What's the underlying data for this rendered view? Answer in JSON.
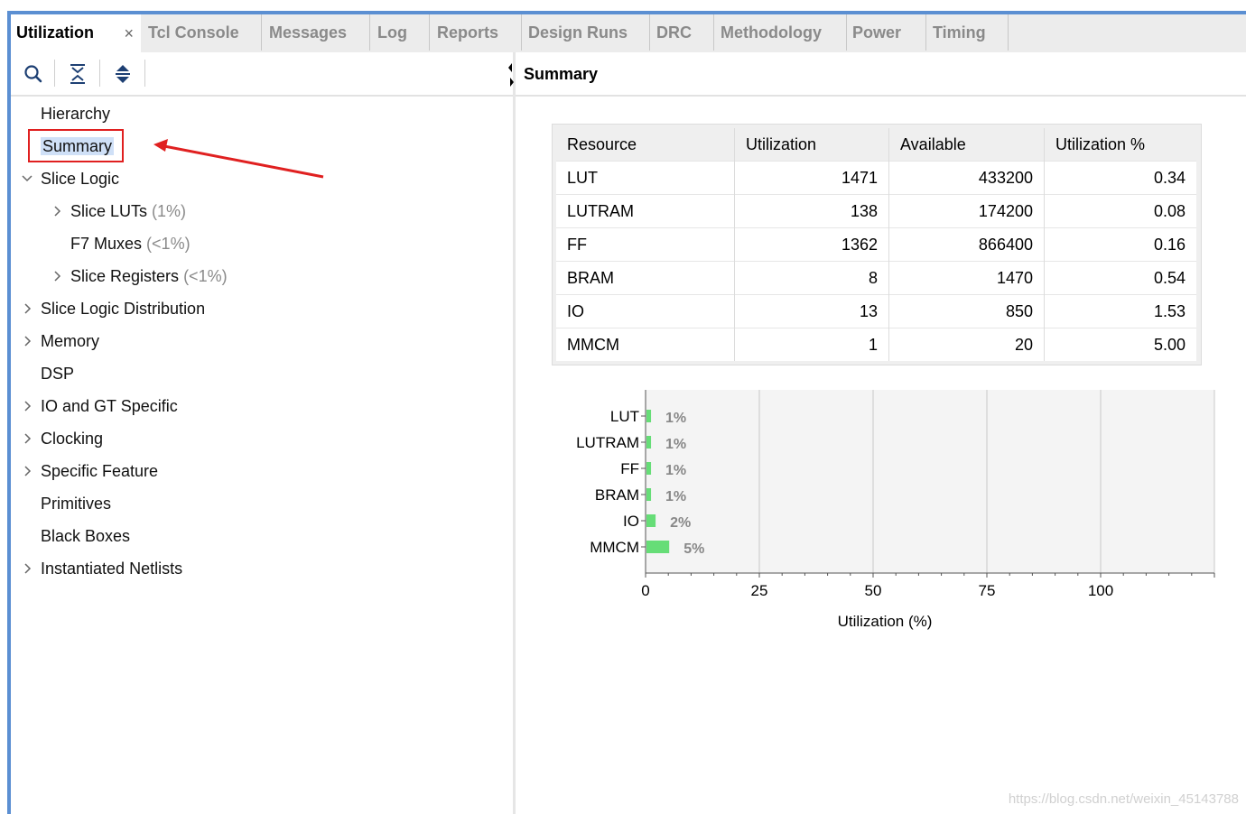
{
  "tabs": [
    {
      "label": "Utilization",
      "active": true,
      "close": "×"
    },
    {
      "label": "Tcl Console"
    },
    {
      "label": "Messages"
    },
    {
      "label": "Log"
    },
    {
      "label": "Reports"
    },
    {
      "label": "Design Runs"
    },
    {
      "label": "DRC"
    },
    {
      "label": "Methodology"
    },
    {
      "label": "Power"
    },
    {
      "label": "Timing"
    }
  ],
  "toolbar": {
    "icons": [
      "search-icon",
      "collapse-all-icon",
      "expand-all-icon"
    ]
  },
  "tree": {
    "hierarchy": "Hierarchy",
    "summary": "Summary",
    "slice_logic": "Slice Logic",
    "slice_luts": "Slice LUTs",
    "slice_luts_pct": "(1%)",
    "f7_muxes": "F7 Muxes",
    "f7_muxes_pct": "(<1%)",
    "slice_registers": "Slice Registers",
    "slice_registers_pct": "(<1%)",
    "slice_logic_distribution": "Slice Logic Distribution",
    "memory": "Memory",
    "dsp": "DSP",
    "io_gt": "IO and GT Specific",
    "clocking": "Clocking",
    "specific_feature": "Specific Feature",
    "primitives": "Primitives",
    "black_boxes": "Black Boxes",
    "instantiated_netlists": "Instantiated Netlists"
  },
  "right": {
    "title": "Summary"
  },
  "table": {
    "headers": [
      "Resource",
      "Utilization",
      "Available",
      "Utilization %"
    ],
    "rows": [
      [
        "LUT",
        "1471",
        "433200",
        "0.34"
      ],
      [
        "LUTRAM",
        "138",
        "174200",
        "0.08"
      ],
      [
        "FF",
        "1362",
        "866400",
        "0.16"
      ],
      [
        "BRAM",
        "8",
        "1470",
        "0.54"
      ],
      [
        "IO",
        "13",
        "850",
        "1.53"
      ],
      [
        "MMCM",
        "1",
        "20",
        "5.00"
      ]
    ]
  },
  "chart_data": {
    "type": "bar",
    "orientation": "horizontal",
    "categories": [
      "LUT",
      "LUTRAM",
      "FF",
      "BRAM",
      "IO",
      "MMCM"
    ],
    "values": [
      1,
      1,
      1,
      1,
      2,
      5
    ],
    "data_labels": [
      "1%",
      "1%",
      "1%",
      "1%",
      "2%",
      "5%"
    ],
    "xlabel": "Utilization (%)",
    "xticks": [
      "0",
      "25",
      "50",
      "75",
      "100"
    ],
    "xlim": [
      0,
      125
    ],
    "bar_color": "#66dd77",
    "grid": true
  },
  "watermark": "https://blog.csdn.net/weixin_45143788"
}
